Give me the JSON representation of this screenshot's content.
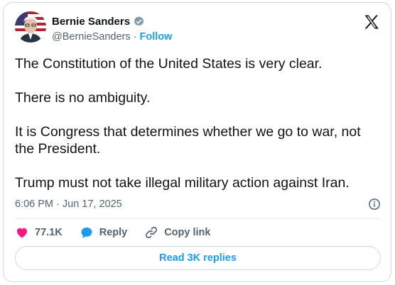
{
  "author": {
    "name": "Bernie Sanders",
    "handle": "@BernieSanders",
    "separator": "·",
    "follow_label": "Follow"
  },
  "tweet": {
    "paragraphs": [
      "The Constitution of the United States is very clear.",
      "There is no ambiguity.",
      "It is Congress that determines whether we go to war, not the President.",
      "Trump must not take illegal military action against Iran."
    ],
    "timestamp": "6:06 PM · Jun 17, 2025"
  },
  "actions": {
    "likes": "77.1K",
    "reply_label": "Reply",
    "copy_link_label": "Copy link"
  },
  "read_replies_label": "Read 3K replies",
  "colors": {
    "accent": "#1d9bf0",
    "like": "#f91880",
    "text": "#0f1419",
    "muted": "#536471",
    "border": "#cfd9de"
  },
  "icons": [
    "verified-badge-icon",
    "x-logo-icon",
    "info-icon",
    "heart-icon",
    "reply-bubble-icon",
    "link-icon"
  ]
}
